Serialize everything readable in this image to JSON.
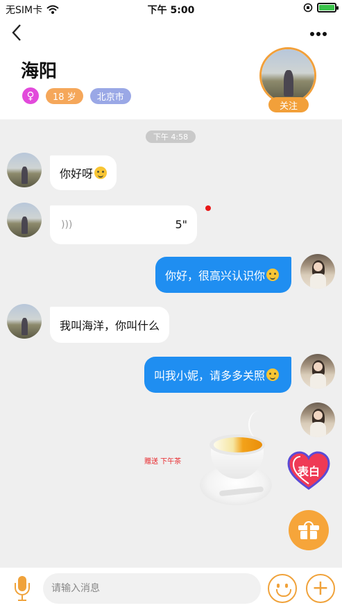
{
  "status_bar": {
    "carrier": "无SIM卡",
    "time": "下午 5:00"
  },
  "header": {
    "back_icon": "chevron-left-icon",
    "more_icon": "more-dots-icon",
    "name": "海阳",
    "gender_icon": "female-icon",
    "age": "18 岁",
    "city": "北京市",
    "follow": "关注"
  },
  "chat": {
    "timestamp": "下午 4:58",
    "messages": [
      {
        "side": "left",
        "text": "你好呀"
      },
      {
        "side": "left",
        "type": "voice",
        "duration": "5\""
      },
      {
        "side": "right",
        "text": "你好，很高兴认识你"
      },
      {
        "side": "left",
        "text": "我叫海洋，你叫什么"
      },
      {
        "side": "right",
        "text": "叫我小妮，请多多关照"
      }
    ],
    "gift": {
      "label": "赠送 下午茶"
    }
  },
  "actions": {
    "confess": "表白",
    "gift_icon": "gift-icon"
  },
  "input_bar": {
    "placeholder": "请输入消息",
    "mic_icon": "microphone-icon",
    "emoji_icon": "smiley-icon",
    "plus_icon": "plus-icon"
  },
  "colors": {
    "accent": "#f2a03a",
    "bubble_right": "#1f8ef1",
    "chat_bg": "#efefef"
  }
}
